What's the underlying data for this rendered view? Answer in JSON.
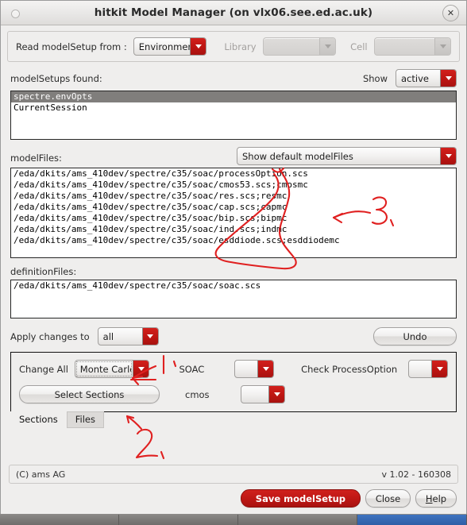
{
  "window": {
    "title": "hitkit Model Manager (on vlx06.see.ed.ac.uk)",
    "close_icon": "close-icon"
  },
  "top": {
    "read_from_label": "Read modelSetup from :",
    "read_from_value": "Environment",
    "library_label": "Library",
    "library_value": "",
    "cell_label": "Cell",
    "cell_value": ""
  },
  "modelsetups": {
    "label": "modelSetups found:",
    "show_label": "Show",
    "show_value": "active",
    "items": [
      {
        "text": "spectre.envOpts",
        "selected": true
      },
      {
        "text": "CurrentSession",
        "selected": false
      }
    ]
  },
  "modelfiles": {
    "label": "modelFiles:",
    "filter_value": "Show default modelFiles",
    "items": [
      "/eda/dkits/ams_410dev/spectre/c35/soac/processOption.scs",
      "/eda/dkits/ams_410dev/spectre/c35/soac/cmos53.scs;cmosmc",
      "/eda/dkits/ams_410dev/spectre/c35/soac/res.scs;resmc",
      "/eda/dkits/ams_410dev/spectre/c35/soac/cap.scs;capmc",
      "/eda/dkits/ams_410dev/spectre/c35/soac/bip.scs;bipmc",
      "/eda/dkits/ams_410dev/spectre/c35/soac/ind.scs;indmc",
      "/eda/dkits/ams_410dev/spectre/c35/soac/esddiode.scs;esddiodemc"
    ]
  },
  "definitionfiles": {
    "label": "definitionFiles:",
    "items": [
      "/eda/dkits/ams_410dev/spectre/c35/soac/soac.scs"
    ]
  },
  "apply": {
    "label": "Apply changes to",
    "value": "all",
    "undo_label": "Undo"
  },
  "sections": {
    "change_all_label": "Change All",
    "change_all_value": "Monte Carlo",
    "select_sections_label": "Select Sections",
    "soac_label": "SOAC",
    "soac_value": "",
    "cmos_label": "cmos",
    "cmos_value": "",
    "check_processoption_label": "Check ProcessOption",
    "check_processoption_value": ""
  },
  "tabs": [
    {
      "label": "Sections",
      "active": true
    },
    {
      "label": "Files",
      "active": false
    }
  ],
  "status": {
    "copyright": "(C) ams AG",
    "version": "v 1.02 - 160308"
  },
  "actions": {
    "save_label": "Save modelSetup",
    "close_label": "Close",
    "help_label": "Help"
  },
  "annotations": {
    "mark_one": "1",
    "mark_two": "2",
    "mark_three": "3",
    "color": "#e02020"
  },
  "colors": {
    "accent_red": "#bd1714",
    "window_bg": "#efeeed",
    "selection": "#807e7c"
  }
}
